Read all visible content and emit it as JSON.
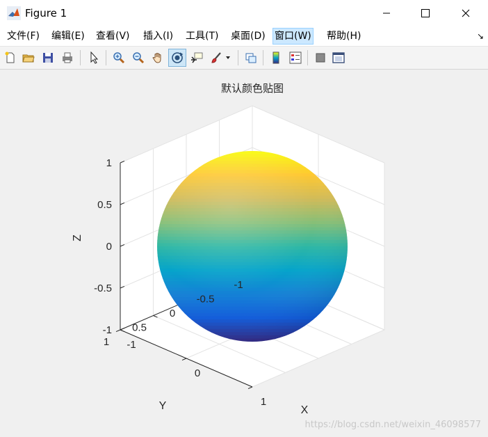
{
  "window": {
    "title": "Figure 1",
    "minimize_glyph": "—",
    "maximize_glyph": "☐",
    "close_glyph": "✕"
  },
  "menu": {
    "items": [
      {
        "label": "文件(F)"
      },
      {
        "label": "编辑(E)"
      },
      {
        "label": "查看(V)"
      },
      {
        "label": "插入(I)"
      },
      {
        "label": "工具(T)"
      },
      {
        "label": "桌面(D)"
      },
      {
        "label": "窗口(W)"
      },
      {
        "label": "帮助(H)"
      }
    ],
    "dock_glyph": "↘"
  },
  "toolbar": {
    "icons": [
      "new-figure-icon",
      "open-file-icon",
      "save-icon",
      "print-icon",
      "pointer-icon",
      "zoom-in-icon",
      "zoom-out-icon",
      "pan-hand-icon",
      "rotate-3d-icon",
      "data-cursor-icon",
      "brush-icon",
      "link-plot-icon",
      "colorbar-icon",
      "legend-icon",
      "hide-plot-tools-icon",
      "show-plot-tools-icon"
    ]
  },
  "colors": {
    "accent_menu": "#cce8ff",
    "figure_bg": "#f0f0f0",
    "axes_bg": "#ffffff",
    "grid": "#e3e3e3",
    "axis_line": "#262626"
  },
  "chart_data": {
    "type": "surface",
    "title": "默认颜色贴图",
    "xlabel": "X",
    "ylabel": "Y",
    "zlabel": "Z",
    "xlim": [
      -1,
      1
    ],
    "ylim": [
      -1,
      1
    ],
    "zlim": [
      -1,
      1
    ],
    "xticks": [
      "-1",
      "0",
      "1"
    ],
    "yticks": [
      "-1",
      "-0.5",
      "0",
      "0.5",
      "1"
    ],
    "zticks": [
      "-1",
      "-0.5",
      "0",
      "0.5",
      "1"
    ],
    "grid": true,
    "colormap": "parula",
    "shape": "unit sphere",
    "colormap_stops": [
      "#352a87",
      "#0f5cdd",
      "#1481d6",
      "#06a4ca",
      "#2eb7a4",
      "#87bf77",
      "#d1bb59",
      "#fec832",
      "#f9fb0e"
    ]
  },
  "watermark": "https://blog.csdn.net/weixin_46098577"
}
